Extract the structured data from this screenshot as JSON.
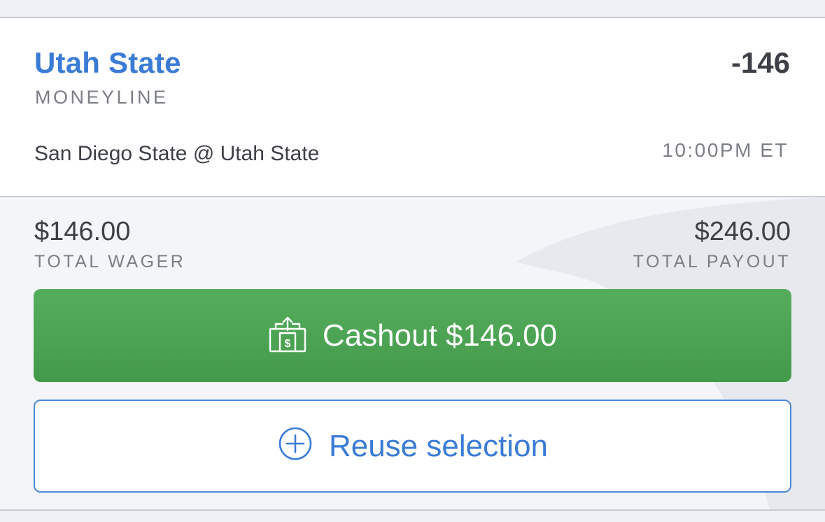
{
  "bet": {
    "selection": "Utah State",
    "odds": "-146",
    "market": "MONEYLINE",
    "matchup": "San Diego State @ Utah State",
    "time": "10:00PM ET"
  },
  "summary": {
    "wager_amount": "$146.00",
    "wager_label": "TOTAL WAGER",
    "payout_amount": "$246.00",
    "payout_label": "TOTAL PAYOUT"
  },
  "actions": {
    "cashout_label": "Cashout $146.00",
    "cashout_icon": "cash-out-icon",
    "reuse_label": "Reuse selection",
    "reuse_icon": "plus-circle-icon"
  },
  "colors": {
    "accent_blue": "#3a7bd5",
    "cashout_green": "#4fa556",
    "text_dark": "#3d4046",
    "text_muted": "#7b7e84"
  }
}
